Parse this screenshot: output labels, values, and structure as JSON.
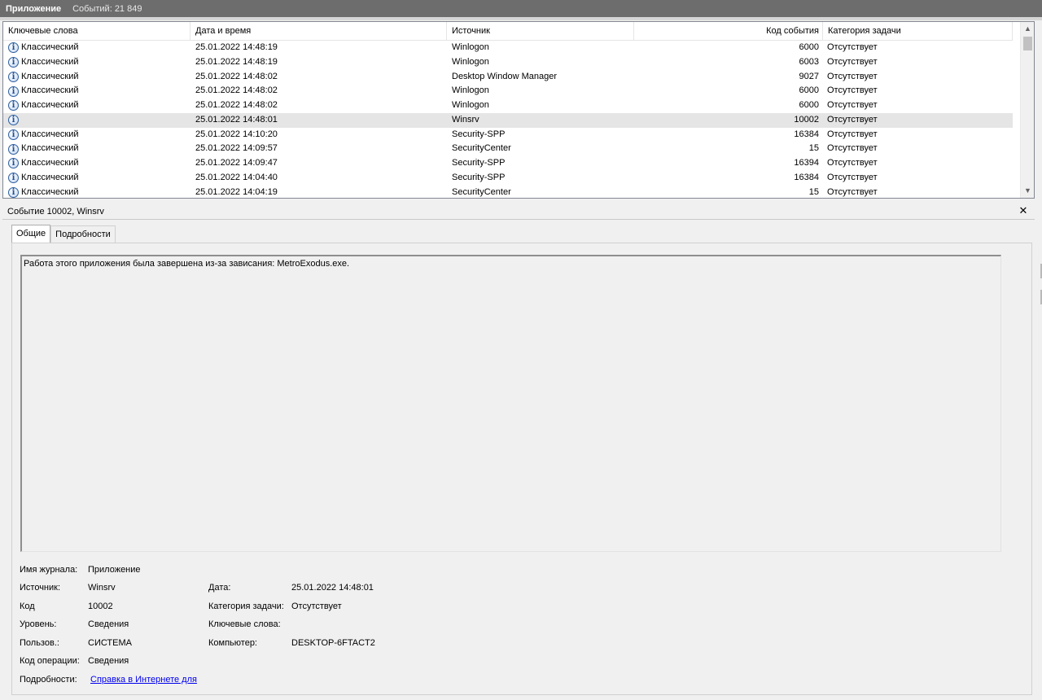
{
  "titlebar": {
    "name": "Приложение",
    "count": "Событий: 21 849"
  },
  "list": {
    "columns": {
      "keywords": "Ключевые слова",
      "datetime": "Дата и время",
      "source": "Источник",
      "event_code": "Код события",
      "task_category": "Категория задачи"
    },
    "rows": [
      {
        "keywords": "Классический",
        "datetime": "25.01.2022 14:48:19",
        "source": "Winlogon",
        "code": "6000",
        "category": "Отсутствует"
      },
      {
        "keywords": "Классический",
        "datetime": "25.01.2022 14:48:19",
        "source": "Winlogon",
        "code": "6003",
        "category": "Отсутствует"
      },
      {
        "keywords": "Классический",
        "datetime": "25.01.2022 14:48:02",
        "source": "Desktop Window Manager",
        "code": "9027",
        "category": "Отсутствует"
      },
      {
        "keywords": "Классический",
        "datetime": "25.01.2022 14:48:02",
        "source": "Winlogon",
        "code": "6000",
        "category": "Отсутствует"
      },
      {
        "keywords": "Классический",
        "datetime": "25.01.2022 14:48:02",
        "source": "Winlogon",
        "code": "6000",
        "category": "Отсутствует"
      },
      {
        "keywords": "",
        "datetime": "25.01.2022 14:48:01",
        "source": "Winsrv",
        "code": "10002",
        "category": "Отсутствует"
      },
      {
        "keywords": "Классический",
        "datetime": "25.01.2022 14:10:20",
        "source": "Security-SPP",
        "code": "16384",
        "category": "Отсутствует"
      },
      {
        "keywords": "Классический",
        "datetime": "25.01.2022 14:09:57",
        "source": "SecurityCenter",
        "code": "15",
        "category": "Отсутствует"
      },
      {
        "keywords": "Классический",
        "datetime": "25.01.2022 14:09:47",
        "source": "Security-SPP",
        "code": "16394",
        "category": "Отсутствует"
      },
      {
        "keywords": "Классический",
        "datetime": "25.01.2022 14:04:40",
        "source": "Security-SPP",
        "code": "16384",
        "category": "Отсутствует"
      },
      {
        "keywords": "Классический",
        "datetime": "25.01.2022 14:04:19",
        "source": "SecurityCenter",
        "code": "15",
        "category": "Отсутствует"
      }
    ],
    "selected_index": 5,
    "icon": "information-icon",
    "icon_glyph": "i"
  },
  "detail": {
    "title": "Событие 10002, Winsrv",
    "close_glyph": "✕",
    "tabs": [
      {
        "label": "Общие"
      },
      {
        "label": "Подробности"
      }
    ],
    "active_tab": 0,
    "message": "Работа этого приложения была завершена из-за зависания: MetroExodus.exe.",
    "fields": {
      "log_name_label": "Имя журнала:",
      "log_name": "Приложение",
      "source_label": "Источник:",
      "source": "Winsrv",
      "date_label": "Дата:",
      "date": "25.01.2022 14:48:01",
      "code_label": "Код",
      "code": "10002",
      "task_category_label": "Категория задачи:",
      "task_category": "Отсутствует",
      "level_label": "Уровень:",
      "level": "Сведения",
      "keywords_label": "Ключевые слова:",
      "keywords": "",
      "user_label": "Пользов.:",
      "user": "СИСТЕМА",
      "computer_label": "Компьютер:",
      "computer": "DESKTOP-6FTACT2",
      "opcode_label": "Код операции:",
      "opcode": "Сведения",
      "details_label": "Подробности:",
      "details_link": "Справка в Интернете для"
    }
  },
  "scrollbar": {
    "up_glyph": "▲",
    "down_glyph": "▼"
  }
}
